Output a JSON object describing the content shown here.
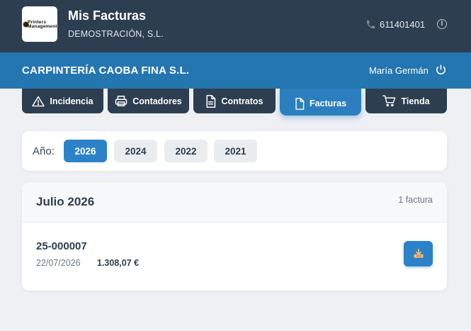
{
  "header": {
    "logo_text_top": "Printers",
    "logo_text_bottom": "Management",
    "title": "Mis Facturas",
    "company": "DEMOSTRACIÓN, S.L.",
    "phone": "611401401",
    "info_icon": "info-icon",
    "phone_icon": "phone-icon"
  },
  "client_bar": {
    "client_name": "CARPINTERÍA CAOBA FINA S.L.",
    "user_name": "María Germán",
    "logout_icon": "power-icon"
  },
  "tabs": [
    {
      "label": "Incidencia",
      "icon": "warning-icon",
      "active": false
    },
    {
      "label": "Contadores",
      "icon": "printer-icon",
      "active": false
    },
    {
      "label": "Contratos",
      "icon": "document-icon",
      "active": false
    },
    {
      "label": "Facturas",
      "icon": "file-icon",
      "active": true
    },
    {
      "label": "Tienda",
      "icon": "cart-icon",
      "active": false
    }
  ],
  "year_filter": {
    "label": "Año:",
    "years": [
      "2026",
      "2024",
      "2022",
      "2021"
    ],
    "selected": "2026"
  },
  "month_group": {
    "title": "Julio 2026",
    "count": "1 factura",
    "invoices": [
      {
        "number": "25-000007",
        "date": "22/07/2026",
        "amount": "1.308,07 €",
        "action_icon": "download-icon"
      }
    ]
  },
  "colors": {
    "header_bg": "#2d3e50",
    "client_bar_bg": "#2476b0",
    "accent": "#2c82c9",
    "page_bg": "#eef0f4"
  }
}
